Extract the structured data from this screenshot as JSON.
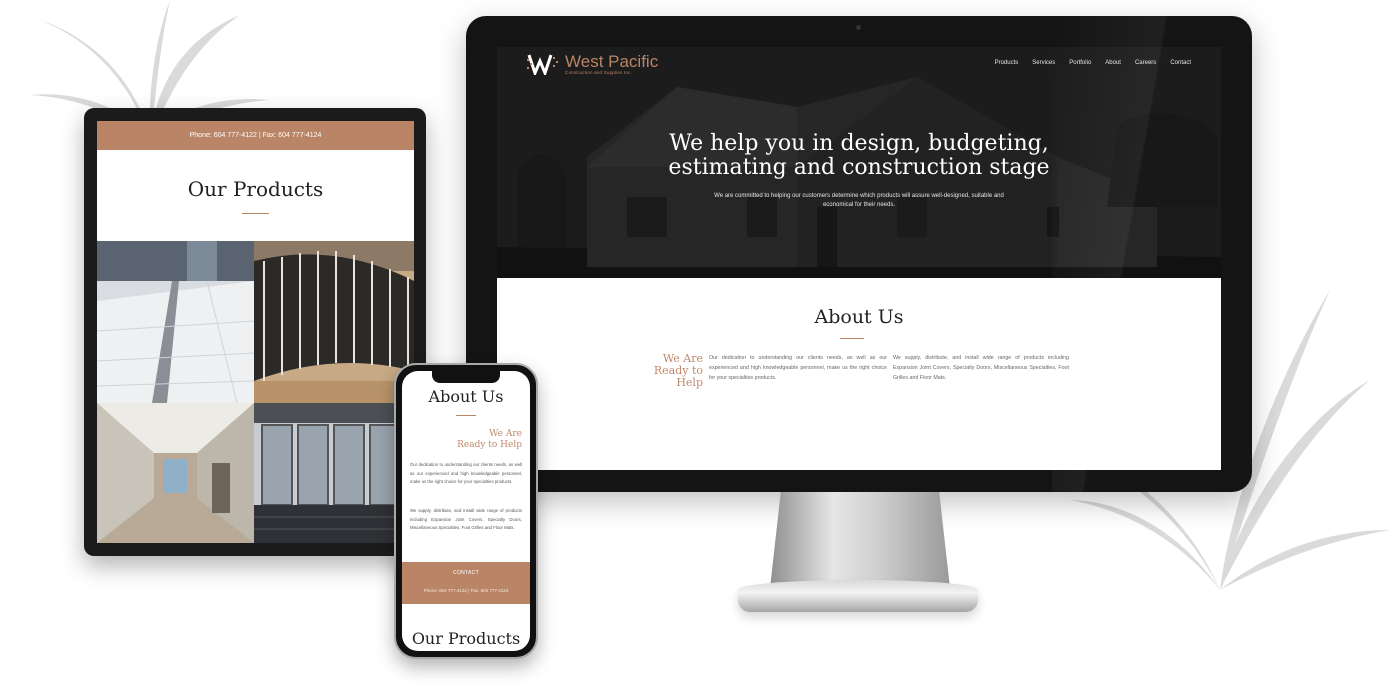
{
  "monitor": {
    "logo": {
      "name": "West Pacific",
      "tagline": "Construction and Supplies Inc."
    },
    "nav": [
      "Products",
      "Services",
      "Portfolio",
      "About",
      "Careers",
      "Contact"
    ],
    "hero": {
      "title_line1": "We help you in design, budgeting,",
      "title_line2": "estimating and construction stage",
      "text": "We are committed to helping our customers determine which products will assure well-designed, suitable and economical for their needs."
    },
    "about": {
      "title": "About Us",
      "ready_line1": "We Are",
      "ready_line2": "Ready to",
      "ready_line3": "Help",
      "col1": "Our dedication to understanding our clients needs, as well as our experienced and high knowledgeable personnel, make us the right choice for your specialties products.",
      "col2": "We supply, distribute, and install wide range of products including Expansion Joint Covers, Specialty Doors, Miscellaneous Specialties, Foot Grilles and Floor Mats."
    }
  },
  "tablet": {
    "topbar": "Phone: 604 777-4122 | Fax: 604 777-4124",
    "title": "Our Products"
  },
  "phone": {
    "title": "About Us",
    "ready_line1": "We Are",
    "ready_line2": "Ready to Help",
    "text1": "Our dedication to understanding our clients needs, as well as our experienced and high knowledgeable personnel, make us the right choice for your specialties products.",
    "text2": "We supply, distribute, and install wide range of products including Expansion Joint Covers, Specialty Doors, Miscellaneous Specialties, Foot Grilles and Floor Mats.",
    "contact": "CONTACT",
    "band_text": "Phone: 604 777-4122 | Fax: 604 777-4124",
    "products_title": "Our Products"
  },
  "colors": {
    "accent": "#b98566",
    "dark": "#141414"
  }
}
